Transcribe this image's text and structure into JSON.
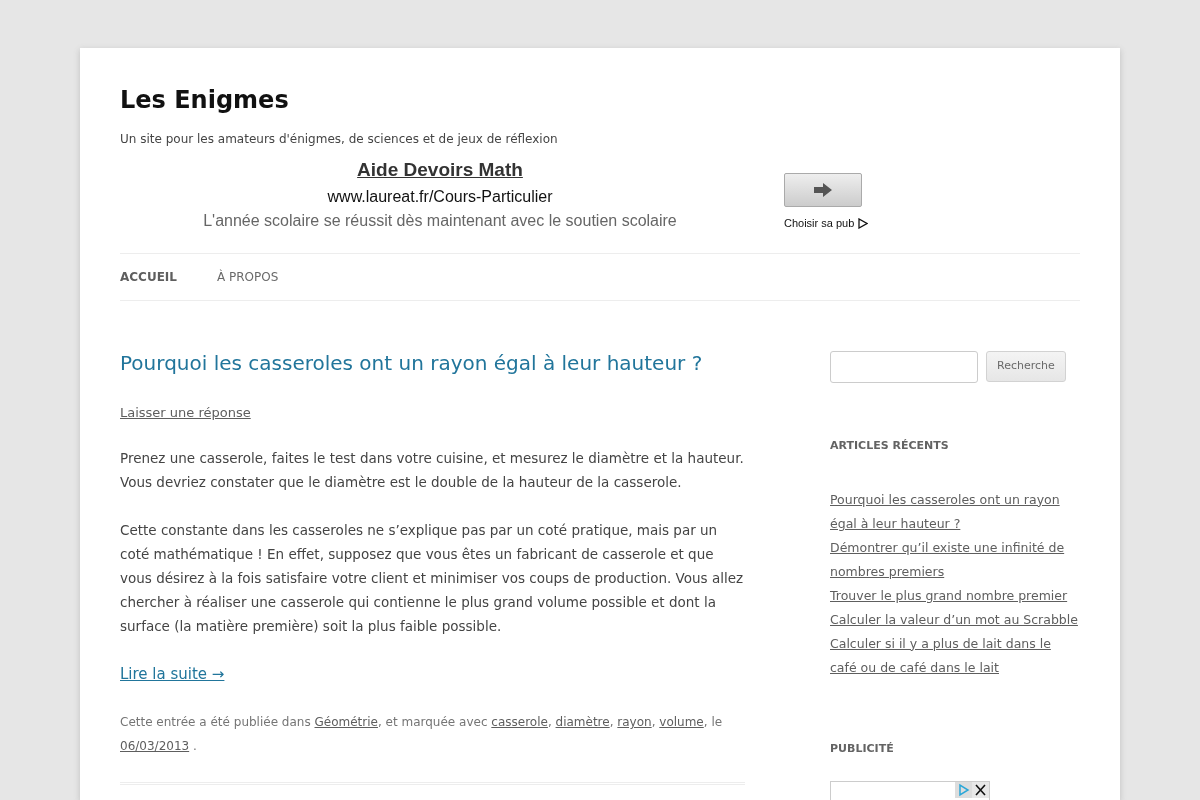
{
  "site": {
    "title": "Les Enigmes",
    "tagline": "Un site pour les amateurs d'énigmes, de sciences et de jeux de réflexion"
  },
  "ad": {
    "headline": "Aide Devoirs Math",
    "url": "www.laureat.fr/Cours-Particulier",
    "description": "L'année scolaire se réussit dès maintenant avec le soutien scolaire",
    "choice_label": "Choisir sa pub"
  },
  "nav": [
    {
      "label": "ACCUEIL",
      "selected": true
    },
    {
      "label": "À PROPOS",
      "selected": false
    }
  ],
  "post": {
    "title": "Pourquoi les casseroles ont un rayon égal à leur hauteur ?",
    "reply_link": "Laisser une réponse",
    "paragraphs": [
      "Prenez une casserole, faites le test dans votre cuisine, et mesurez le diamètre et la hauteur. Vous devriez constater que le diamètre est le double de la hauteur de la casserole.",
      "Cette constante dans les casseroles ne s’explique pas par un coté pratique, mais par un coté mathématique ! En effet, supposez que vous êtes un fabricant de casserole et que vous désirez à la fois satisfaire votre client et minimiser vos coups de production. Vous allez chercher à réaliser une casserole qui contienne le plus grand volume possible et dont la surface (la matière première) soit la plus faible possible."
    ],
    "more_link": "Lire la suite →",
    "meta": {
      "prefix": "Cette entrée a été publiée dans ",
      "category": "Géométrie",
      "middle": ", et marquée avec ",
      "tags": [
        "casserole",
        "diamètre",
        "rayon",
        "volume"
      ],
      "tag_separator": ", ",
      "before_date": ", le ",
      "date": "06/03/2013",
      "end": " ."
    }
  },
  "sidebar": {
    "search": {
      "button": "Recherche"
    },
    "recent_title": "ARTICLES RÉCENTS",
    "recent": [
      "Pourquoi les casseroles ont un rayon égal à leur hauteur ?",
      "Démontrer qu’il existe une infinité de nombres premiers",
      "Trouver le plus grand nombre premier",
      "Calculer la valeur d’un mot au Scrabble",
      "Calculer si il y a plus de lait dans le café ou de café dans le lait"
    ],
    "ad_title": "PUBLICITÉ"
  }
}
